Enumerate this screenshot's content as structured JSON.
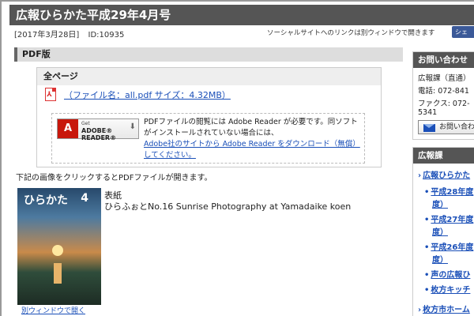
{
  "page": {
    "title": "広報ひらかた平成29年4月号",
    "date": "[2017年3月28日]",
    "id": "ID:10935",
    "social_note": "ソーシャルサイトへのリンクは別ウィンドウで開きます",
    "share_label": "シェ"
  },
  "pdf": {
    "section_title": "PDF版",
    "all_pages_label": "全ページ",
    "file_link": "（ファイル名：all.pdf サイズ：4.32MB）",
    "adobe": {
      "get": "Get",
      "name": "ADOBE® READER®",
      "text_1": "PDFファイルの閲覧には Adobe Reader が必要です。同ソフトがインストールされていない場合には、",
      "link": "Adobe社のサイトから Adobe Reader をダウンロード（無償）してください。"
    },
    "click_note": "下記の画像をクリックするとPDFファイルが開きます。"
  },
  "cover": {
    "logo": "ひらかた",
    "number": "4",
    "label": "表紙",
    "description": "ひらふぉとNo.16 Sunrise Photography at Yamadaike koen",
    "link": "別ウィンドウで開く"
  },
  "sidebar": {
    "contact_title": "お問い合わせ",
    "dept": "広報課（直通）",
    "phone": "電話: 072-841",
    "fax": "ファクス: 072-",
    "fax_cont": "5341",
    "inquiry_button": "お問い合わせ",
    "nav_title": "広報課",
    "nav_items": [
      "広報ひらかた",
      "平成28年度",
      "度）",
      "平成27年度",
      "度）",
      "平成26年度",
      "度）",
      "声の広報ひ",
      "枚方キッチ",
      "枚方市ホーム"
    ]
  }
}
